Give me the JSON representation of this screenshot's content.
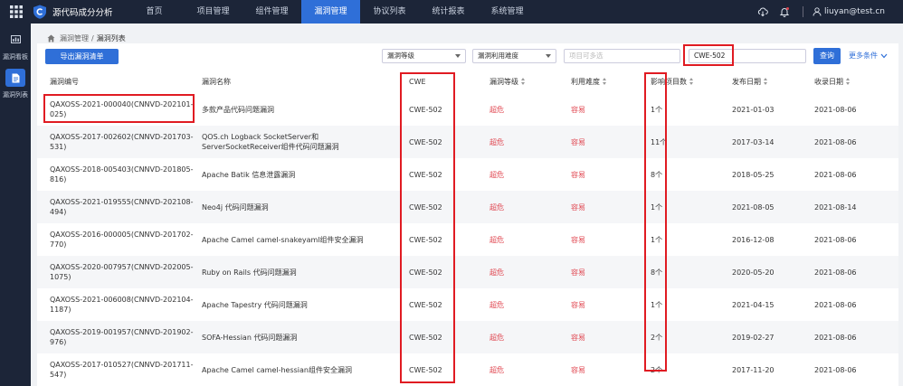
{
  "app": {
    "title": "源代码成分分析"
  },
  "nav": [
    {
      "label": "首页"
    },
    {
      "label": "项目管理"
    },
    {
      "label": "组件管理"
    },
    {
      "label": "漏洞管理"
    },
    {
      "label": "协议列表"
    },
    {
      "label": "统计报表"
    },
    {
      "label": "系统管理"
    }
  ],
  "user": {
    "email": "liuyan@test.cn"
  },
  "side": [
    {
      "label": "漏洞看板"
    },
    {
      "label": "漏洞列表"
    }
  ],
  "breadcrumb": {
    "parent": "漏洞管理",
    "separator": "/",
    "current": "漏洞列表"
  },
  "toolbar": {
    "export_label": "导出漏洞清单",
    "severity_select": "漏洞等级",
    "difficulty_select": "漏洞利用难度",
    "project_placeholder": "项目可多选",
    "search_value": "CWE-502",
    "query_label": "查询",
    "more_label": "更多条件"
  },
  "table": {
    "headers": {
      "id": "漏洞编号",
      "name": "漏洞名称",
      "cwe": "CWE",
      "level": "漏洞等级",
      "difficulty": "利用难度",
      "count": "影响项目数",
      "published": "发布日期",
      "collected": "收录日期"
    },
    "rows": [
      {
        "id": "QAXOSS-2021-000040(CNNVD-202101-025)",
        "name": "多款产品代码问题漏洞",
        "cwe": "CWE-502",
        "level": "超危",
        "difficulty": "容易",
        "count": "1个",
        "published": "2021-01-03",
        "collected": "2021-08-06"
      },
      {
        "id": "QAXOSS-2017-002602(CNNVD-201703-531)",
        "name": "QOS.ch Logback SocketServer和ServerSocketReceiver组件代码问题漏洞",
        "cwe": "CWE-502",
        "level": "超危",
        "difficulty": "容易",
        "count": "11个",
        "published": "2017-03-14",
        "collected": "2021-08-06"
      },
      {
        "id": "QAXOSS-2018-005403(CNNVD-201805-816)",
        "name": "Apache Batik 信息泄露漏洞",
        "cwe": "CWE-502",
        "level": "超危",
        "difficulty": "容易",
        "count": "8个",
        "published": "2018-05-25",
        "collected": "2021-08-06"
      },
      {
        "id": "QAXOSS-2021-019555(CNNVD-202108-494)",
        "name": "Neo4j 代码问题漏洞",
        "cwe": "CWE-502",
        "level": "超危",
        "difficulty": "容易",
        "count": "1个",
        "published": "2021-08-05",
        "collected": "2021-08-14"
      },
      {
        "id": "QAXOSS-2016-000005(CNNVD-201702-770)",
        "name": "Apache Camel camel-snakeyaml组件安全漏洞",
        "cwe": "CWE-502",
        "level": "超危",
        "difficulty": "容易",
        "count": "1个",
        "published": "2016-12-08",
        "collected": "2021-08-06"
      },
      {
        "id": "QAXOSS-2020-007957(CNNVD-202005-1075)",
        "name": "Ruby on Rails 代码问题漏洞",
        "cwe": "CWE-502",
        "level": "超危",
        "difficulty": "容易",
        "count": "8个",
        "published": "2020-05-20",
        "collected": "2021-08-06"
      },
      {
        "id": "QAXOSS-2021-006008(CNNVD-202104-1187)",
        "name": "Apache Tapestry 代码问题漏洞",
        "cwe": "CWE-502",
        "level": "超危",
        "difficulty": "容易",
        "count": "1个",
        "published": "2021-04-15",
        "collected": "2021-08-06"
      },
      {
        "id": "QAXOSS-2019-001957(CNNVD-201902-976)",
        "name": "SOFA-Hessian 代码问题漏洞",
        "cwe": "CWE-502",
        "level": "超危",
        "difficulty": "容易",
        "count": "2个",
        "published": "2019-02-27",
        "collected": "2021-08-06"
      },
      {
        "id": "QAXOSS-2017-010527(CNNVD-201711-547)",
        "name": "Apache Camel camel-hessian组件安全漏洞",
        "cwe": "CWE-502",
        "level": "超危",
        "difficulty": "容易",
        "count": "2个",
        "published": "2017-11-20",
        "collected": "2021-08-06"
      }
    ]
  },
  "colors": {
    "nav_bg": "#1c2538",
    "accent": "#2f6fd8",
    "danger": "#e0454f",
    "highlight": "#e01b22"
  }
}
